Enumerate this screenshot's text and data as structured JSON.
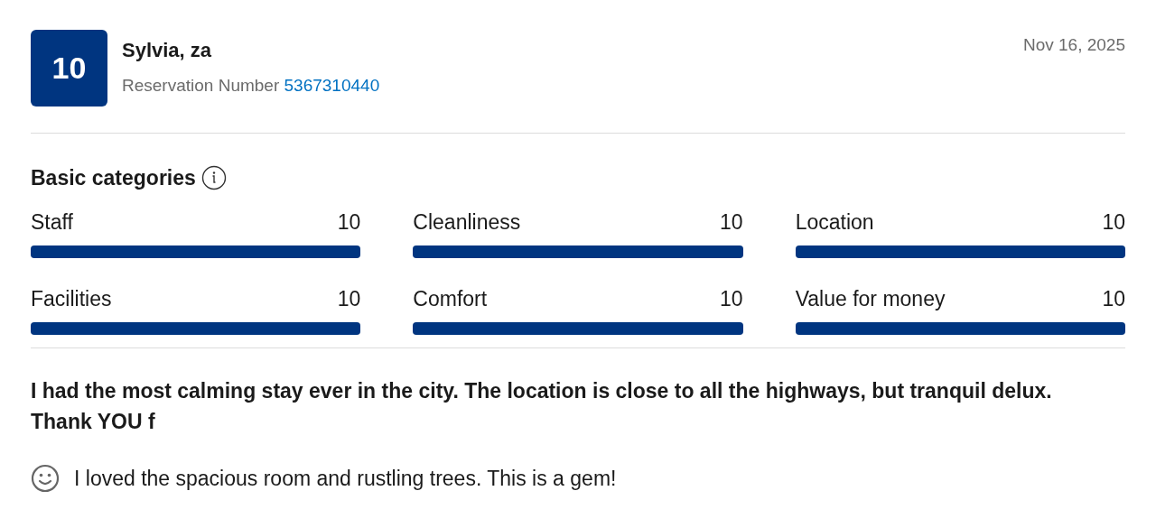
{
  "review": {
    "score": "10",
    "name": "Sylvia, za",
    "reservation_label": "Reservation Number",
    "reservation_number": "5367310440",
    "date": "Nov 16, 2025"
  },
  "categories": {
    "title": "Basic categories",
    "items": [
      {
        "label": "Staff",
        "score": "10",
        "level": 1
      },
      {
        "label": "Cleanliness",
        "score": "10",
        "level": 1
      },
      {
        "label": "Location",
        "score": "10",
        "level": 1
      },
      {
        "label": "Facilities",
        "score": "10",
        "level": 1
      },
      {
        "label": "Comfort",
        "score": "10",
        "level": 1
      },
      {
        "label": "Value for money",
        "score": "10",
        "level": 1
      }
    ]
  },
  "headline": "I had the most calming stay ever in the city. The location is close to all the highways, but tranquil delux. Thank YOU f",
  "positive": "I loved the spacious room and rustling trees. This is a gem!"
}
